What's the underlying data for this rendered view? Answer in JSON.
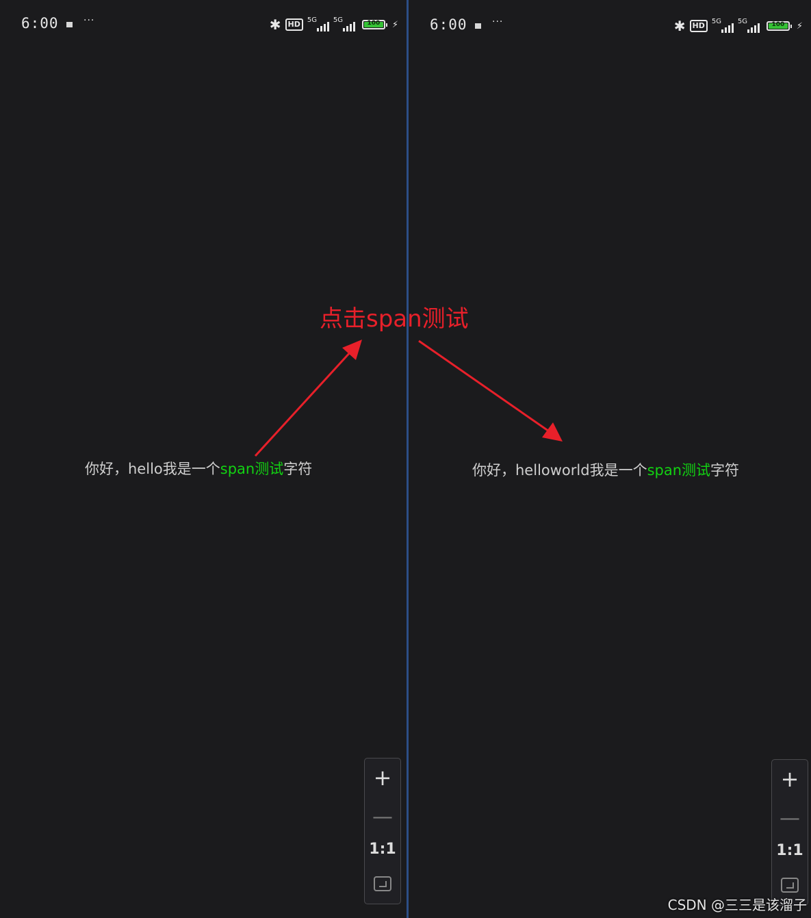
{
  "left_screen": {
    "status": {
      "time": "6:00",
      "dots": "···",
      "hd": "HD",
      "net1": "5G",
      "net2": "5G",
      "battery": "100",
      "battery_level": 1.0
    },
    "text": {
      "before": "你好，hello我是一个",
      "span": "span测试",
      "after": "字符"
    },
    "zoom": {
      "plus": "+",
      "minus": "—",
      "ratio": "1:1"
    }
  },
  "right_screen": {
    "status": {
      "time": "6:00",
      "dots": "···",
      "hd": "HD",
      "net1": "5G",
      "net2": "5G",
      "battery": "100",
      "battery_level": 1.0
    },
    "text": {
      "before": "你好，helloworld我是一个",
      "span": "span测试",
      "after": "字符"
    },
    "zoom": {
      "plus": "+",
      "minus": "—",
      "ratio": "1:1"
    }
  },
  "annotation": {
    "label": "点击span测试",
    "color": "#e8202a"
  },
  "watermark": "CSDN @三三是该溜子",
  "colors": {
    "background": "#1b1b1d",
    "span_text": "#12d212",
    "divider": "#2c4e86",
    "battery_fill": "#35c235"
  }
}
